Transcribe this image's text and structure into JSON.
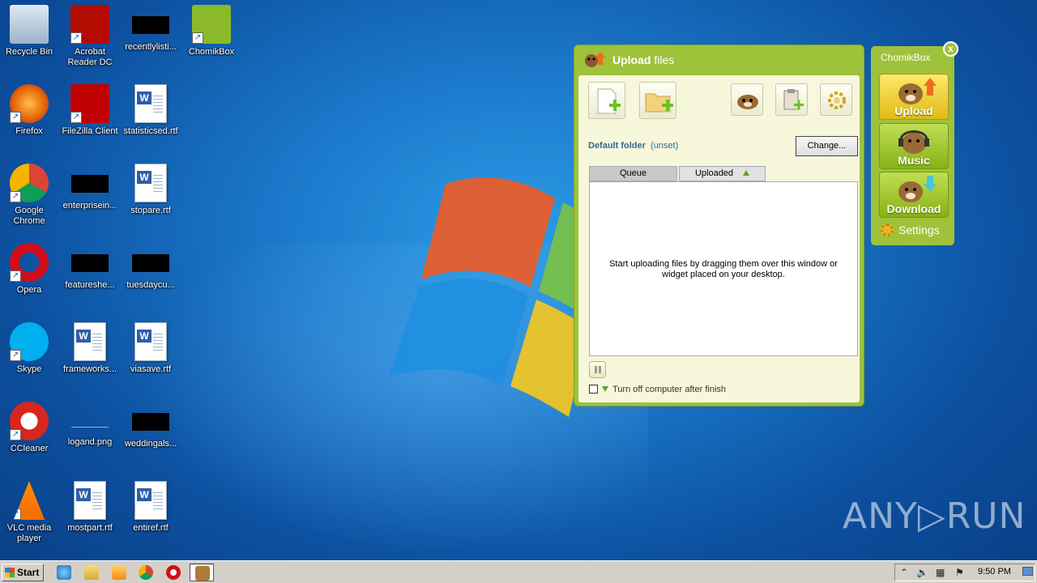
{
  "desktop_icons": [
    {
      "label": "Recycle Bin",
      "icon": "recycle-bin-icon"
    },
    {
      "label": "Acrobat Reader DC",
      "icon": "acrobat-icon"
    },
    {
      "label": "recentlylisti...",
      "icon": "file-icon"
    },
    {
      "label": "ChomikBox",
      "icon": "chomikbox-icon"
    },
    {
      "label": "Firefox",
      "icon": "firefox-icon"
    },
    {
      "label": "FileZilla Client",
      "icon": "filezilla-icon"
    },
    {
      "label": "statisticsed.rtf",
      "icon": "word-doc-icon"
    },
    {
      "label": "Google Chrome",
      "icon": "chrome-icon"
    },
    {
      "label": "enterprisein...",
      "icon": "file-icon"
    },
    {
      "label": "stopare.rtf",
      "icon": "word-doc-icon"
    },
    {
      "label": "Opera",
      "icon": "opera-icon"
    },
    {
      "label": "featureshe...",
      "icon": "file-icon"
    },
    {
      "label": "tuesdaycu...",
      "icon": "file-icon"
    },
    {
      "label": "Skype",
      "icon": "skype-icon"
    },
    {
      "label": "frameworks...",
      "icon": "word-doc-icon"
    },
    {
      "label": "viasave.rtf",
      "icon": "word-doc-icon"
    },
    {
      "label": "CCleaner",
      "icon": "ccleaner-icon"
    },
    {
      "label": "logand.png",
      "icon": "image-icon"
    },
    {
      "label": "weddingals...",
      "icon": "file-icon"
    },
    {
      "label": "VLC media player",
      "icon": "vlc-icon"
    },
    {
      "label": "mostpart.rtf",
      "icon": "word-doc-icon"
    },
    {
      "label": "entiref.rtf",
      "icon": "word-doc-icon"
    }
  ],
  "upload_window": {
    "title_bold": "Upload",
    "title_rest": " files",
    "default_folder_label": "Default folder",
    "default_folder_value": "(unset)",
    "change_button": "Change...",
    "tabs": [
      "Queue",
      "Uploaded"
    ],
    "empty_message": "Start uploading files by dragging them over this window or widget placed on your desktop.",
    "turn_off_label": "Turn off computer after finish"
  },
  "widget": {
    "title": "ChomikBox",
    "close": "x",
    "buttons": [
      "Upload",
      "Music",
      "Download"
    ],
    "settings": "Settings"
  },
  "watermark": "ANY▷RUN",
  "taskbar": {
    "start": "Start",
    "clock": "9:50 PM"
  },
  "colors": {
    "chomik_green": "#9ec23a",
    "panel_cream": "#f7f7dc",
    "folder_text": "#2c6b92"
  }
}
